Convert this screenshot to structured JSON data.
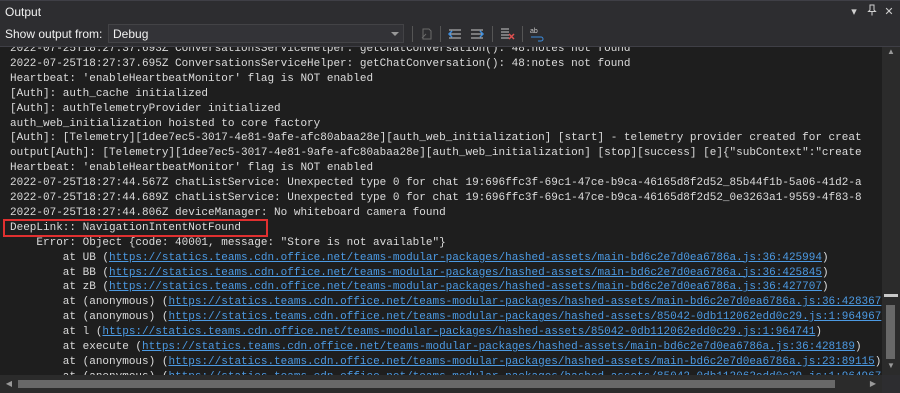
{
  "panel": {
    "title": "Output"
  },
  "toolbar": {
    "show_output_label": "Show output from:",
    "source_value": "Debug"
  },
  "lines": [
    {
      "text": "2022-07-25T18:27:37.693Z ConversationsServiceHelper: getChatConversation(): 48:notes not found"
    },
    {
      "text": "2022-07-25T18:27:37.695Z ConversationsServiceHelper: getChatConversation(): 48:notes not found"
    },
    {
      "text": "Heartbeat: 'enableHeartbeatMonitor' flag is NOT enabled"
    },
    {
      "text": "[Auth]: auth_cache initialized"
    },
    {
      "text": "[Auth]: authTelemetryProvider initialized"
    },
    {
      "text": "auth_web_initialization hoisted to core factory"
    },
    {
      "text": "[Auth]: [Telemetry][1dee7ec5-3017-4e81-9afe-afc80abaa28e][auth_web_initialization] [start] - telemetry provider created for creat"
    },
    {
      "text": "output[Auth]: [Telemetry][1dee7ec5-3017-4e81-9afe-afc80abaa28e][auth_web_initialization] [stop][success] [e]{\"subContext\":\"create"
    },
    {
      "text": "Heartbeat: 'enableHeartbeatMonitor' flag is NOT enabled"
    },
    {
      "text": "2022-07-25T18:27:44.567Z chatListService: Unexpected type 0 for chat 19:696ffc3f-69c1-47ce-b9ca-46165d8f2d52_85b44f1b-5a06-41d2-a"
    },
    {
      "text": "2022-07-25T18:27:44.689Z chatListService: Unexpected type 0 for chat 19:696ffc3f-69c1-47ce-b9ca-46165d8f2d52_0e3263a1-9559-4f83-8"
    },
    {
      "text": "2022-07-25T18:27:44.806Z deviceManager: No whiteboard camera found"
    },
    {
      "text": "DeepLink:: NavigationIntentNotFound"
    },
    {
      "text": "Error: Object {code: 40001, message: \"Store is not available\"}",
      "indent": "    "
    },
    {
      "pre": "        at UB (",
      "link": "https://statics.teams.cdn.office.net/teams-modular-packages/hashed-assets/main-bd6c2e7d0ea6786a.js:36:425994",
      "post": ")"
    },
    {
      "pre": "        at BB (",
      "link": "https://statics.teams.cdn.office.net/teams-modular-packages/hashed-assets/main-bd6c2e7d0ea6786a.js:36:425845",
      "post": ")"
    },
    {
      "pre": "        at zB (",
      "link": "https://statics.teams.cdn.office.net/teams-modular-packages/hashed-assets/main-bd6c2e7d0ea6786a.js:36:427707",
      "post": ")"
    },
    {
      "pre": "        at (anonymous) (",
      "link": "https://statics.teams.cdn.office.net/teams-modular-packages/hashed-assets/main-bd6c2e7d0ea6786a.js:36:428367",
      "post": ")"
    },
    {
      "pre": "        at (anonymous) (",
      "link": "https://statics.teams.cdn.office.net/teams-modular-packages/hashed-assets/85042-0db112062edd0c29.js:1:964967",
      "post": ")"
    },
    {
      "pre": "        at l (",
      "link": "https://statics.teams.cdn.office.net/teams-modular-packages/hashed-assets/85042-0db112062edd0c29.js:1:964741",
      "post": ")"
    },
    {
      "pre": "        at execute (",
      "link": "https://statics.teams.cdn.office.net/teams-modular-packages/hashed-assets/main-bd6c2e7d0ea6786a.js:36:428189",
      "post": ")"
    },
    {
      "pre": "        at (anonymous) (",
      "link": "https://statics.teams.cdn.office.net/teams-modular-packages/hashed-assets/main-bd6c2e7d0ea6786a.js:23:89115",
      "post": ")"
    },
    {
      "pre": "        at (anonymous) (",
      "link": "https://statics.teams.cdn.office.net/teams-modular-packages/hashed-assets/85042-0db112062edd0c29.js:1:964967",
      "post": ")"
    }
  ],
  "icons": {
    "pin": "pin-icon",
    "close": "close-icon",
    "dropdown": "chevron-down-icon"
  },
  "colors": {
    "link": "#4c9ae3",
    "highlight_border": "#e03030"
  }
}
